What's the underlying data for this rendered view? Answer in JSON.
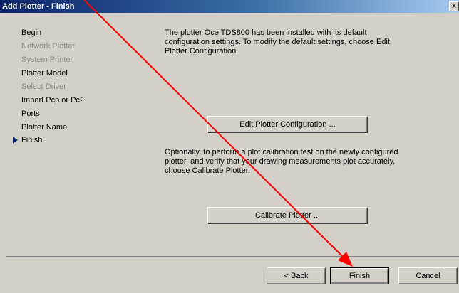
{
  "window": {
    "title": "Add Plotter - Finish",
    "close_glyph": "x"
  },
  "steps": [
    {
      "label": "Begin",
      "enabled": true
    },
    {
      "label": "Network Plotter",
      "enabled": false
    },
    {
      "label": "System Printer",
      "enabled": false
    },
    {
      "label": "Plotter Model",
      "enabled": true
    },
    {
      "label": "Select Driver",
      "enabled": false
    },
    {
      "label": "Import Pcp or Pc2",
      "enabled": true
    },
    {
      "label": "Ports",
      "enabled": true
    },
    {
      "label": "Plotter Name",
      "enabled": true
    },
    {
      "label": "Finish",
      "enabled": true,
      "current": true
    }
  ],
  "main": {
    "intro_text": "The plotter Oce TDS800 has been installed with its default configuration settings.  To modify the default settings, choose Edit Plotter Configuration.",
    "edit_config_label": "Edit Plotter Configuration ...",
    "calibrate_text": "Optionally, to perform a plot calibration test on the newly configured plotter, and verify that your drawing measurements plot accurately, choose Calibrate Plotter.",
    "calibrate_label": "Calibrate Plotter ..."
  },
  "footer": {
    "back_label": "< Back",
    "finish_label": "Finish",
    "cancel_label": "Cancel"
  },
  "annotation": {
    "arrow_color": "#ff0000",
    "marker_icon": "triangle-right-icon"
  }
}
